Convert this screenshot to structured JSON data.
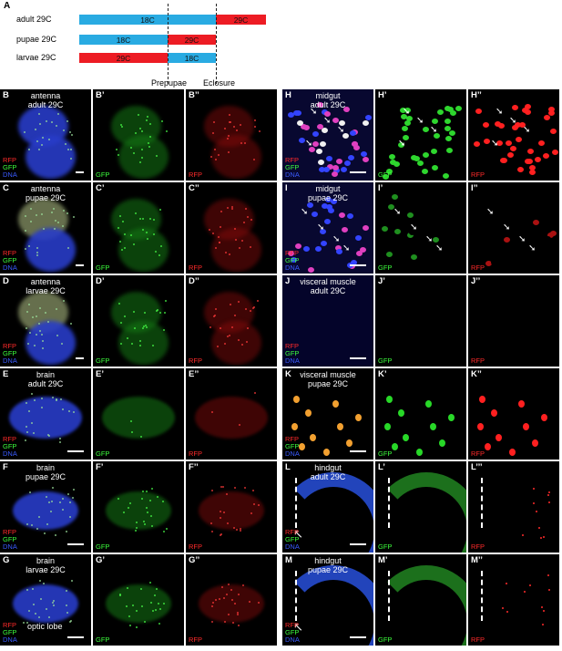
{
  "panel_a": {
    "letter": "A",
    "rows": [
      {
        "label": "adult 29C",
        "segments": [
          {
            "text": "18C",
            "color": "blue"
          },
          {
            "text": "29C",
            "color": "red"
          }
        ]
      },
      {
        "label": "pupae 29C",
        "segments": [
          {
            "text": "18C",
            "color": "blue"
          },
          {
            "text": "29C",
            "color": "red"
          }
        ]
      },
      {
        "label": "larvae 29C",
        "segments": [
          {
            "text": "29C",
            "color": "red"
          },
          {
            "text": "18C",
            "color": "blue"
          }
        ]
      }
    ],
    "stage_labels": [
      "Prepupae",
      "Eclosure"
    ],
    "colors": {
      "blue": "#29abe2",
      "red": "#ed1c24"
    }
  },
  "channels": {
    "rfp": "RFP",
    "gfp": "GFP",
    "dna": "DNA"
  },
  "left_rows": [
    {
      "letters": [
        "B",
        "B’",
        "B’’"
      ],
      "caption": [
        "antenna",
        "adult 29C"
      ]
    },
    {
      "letters": [
        "C",
        "C’",
        "C’’"
      ],
      "caption": [
        "antenna",
        "pupae 29C"
      ]
    },
    {
      "letters": [
        "D",
        "D’",
        "D’’"
      ],
      "caption": [
        "antenna",
        "larvae 29C"
      ]
    },
    {
      "letters": [
        "E",
        "E’",
        "E’’"
      ],
      "caption": [
        "brain",
        "adult 29C"
      ]
    },
    {
      "letters": [
        "F",
        "F’",
        "F’’"
      ],
      "caption": [
        "brain",
        "pupae 29C"
      ]
    },
    {
      "letters": [
        "G",
        "G’",
        "G’’"
      ],
      "caption": [
        "brain",
        "larvae 29C"
      ],
      "annotation": "optic lobe"
    }
  ],
  "right_rows": [
    {
      "letters": [
        "H",
        "H’",
        "H’’"
      ],
      "caption": [
        "midgut",
        "adult 29C"
      ]
    },
    {
      "letters": [
        "I",
        "I’",
        "I’’"
      ],
      "caption": [
        "midgut",
        "pupae 29C"
      ]
    },
    {
      "letters": [
        "J",
        "J’",
        "J’’"
      ],
      "caption": [
        "visceral muscle",
        "adult 29C"
      ]
    },
    {
      "letters": [
        "K",
        "K’",
        "K’’"
      ],
      "caption": [
        "visceral muscle",
        "pupae 29C"
      ]
    },
    {
      "letters": [
        "L",
        "L’",
        "L’’’"
      ],
      "caption": [
        "hindgut",
        "adult 29C"
      ]
    },
    {
      "letters": [
        "M",
        "M’",
        "M’’"
      ],
      "caption": [
        "hindgut",
        "pupae 29C"
      ]
    }
  ]
}
